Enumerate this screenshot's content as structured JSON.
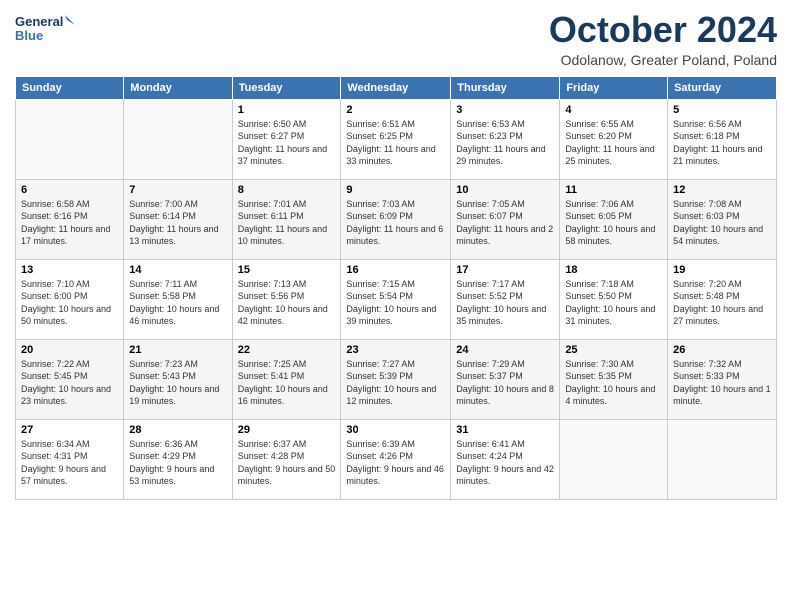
{
  "header": {
    "logo_line1": "General",
    "logo_line2": "Blue",
    "month": "October 2024",
    "location": "Odolanow, Greater Poland, Poland"
  },
  "weekdays": [
    "Sunday",
    "Monday",
    "Tuesday",
    "Wednesday",
    "Thursday",
    "Friday",
    "Saturday"
  ],
  "weeks": [
    [
      {
        "day": "",
        "sunrise": "",
        "sunset": "",
        "daylight": ""
      },
      {
        "day": "",
        "sunrise": "",
        "sunset": "",
        "daylight": ""
      },
      {
        "day": "1",
        "sunrise": "Sunrise: 6:50 AM",
        "sunset": "Sunset: 6:27 PM",
        "daylight": "Daylight: 11 hours and 37 minutes."
      },
      {
        "day": "2",
        "sunrise": "Sunrise: 6:51 AM",
        "sunset": "Sunset: 6:25 PM",
        "daylight": "Daylight: 11 hours and 33 minutes."
      },
      {
        "day": "3",
        "sunrise": "Sunrise: 6:53 AM",
        "sunset": "Sunset: 6:23 PM",
        "daylight": "Daylight: 11 hours and 29 minutes."
      },
      {
        "day": "4",
        "sunrise": "Sunrise: 6:55 AM",
        "sunset": "Sunset: 6:20 PM",
        "daylight": "Daylight: 11 hours and 25 minutes."
      },
      {
        "day": "5",
        "sunrise": "Sunrise: 6:56 AM",
        "sunset": "Sunset: 6:18 PM",
        "daylight": "Daylight: 11 hours and 21 minutes."
      }
    ],
    [
      {
        "day": "6",
        "sunrise": "Sunrise: 6:58 AM",
        "sunset": "Sunset: 6:16 PM",
        "daylight": "Daylight: 11 hours and 17 minutes."
      },
      {
        "day": "7",
        "sunrise": "Sunrise: 7:00 AM",
        "sunset": "Sunset: 6:14 PM",
        "daylight": "Daylight: 11 hours and 13 minutes."
      },
      {
        "day": "8",
        "sunrise": "Sunrise: 7:01 AM",
        "sunset": "Sunset: 6:11 PM",
        "daylight": "Daylight: 11 hours and 10 minutes."
      },
      {
        "day": "9",
        "sunrise": "Sunrise: 7:03 AM",
        "sunset": "Sunset: 6:09 PM",
        "daylight": "Daylight: 11 hours and 6 minutes."
      },
      {
        "day": "10",
        "sunrise": "Sunrise: 7:05 AM",
        "sunset": "Sunset: 6:07 PM",
        "daylight": "Daylight: 11 hours and 2 minutes."
      },
      {
        "day": "11",
        "sunrise": "Sunrise: 7:06 AM",
        "sunset": "Sunset: 6:05 PM",
        "daylight": "Daylight: 10 hours and 58 minutes."
      },
      {
        "day": "12",
        "sunrise": "Sunrise: 7:08 AM",
        "sunset": "Sunset: 6:03 PM",
        "daylight": "Daylight: 10 hours and 54 minutes."
      }
    ],
    [
      {
        "day": "13",
        "sunrise": "Sunrise: 7:10 AM",
        "sunset": "Sunset: 6:00 PM",
        "daylight": "Daylight: 10 hours and 50 minutes."
      },
      {
        "day": "14",
        "sunrise": "Sunrise: 7:11 AM",
        "sunset": "Sunset: 5:58 PM",
        "daylight": "Daylight: 10 hours and 46 minutes."
      },
      {
        "day": "15",
        "sunrise": "Sunrise: 7:13 AM",
        "sunset": "Sunset: 5:56 PM",
        "daylight": "Daylight: 10 hours and 42 minutes."
      },
      {
        "day": "16",
        "sunrise": "Sunrise: 7:15 AM",
        "sunset": "Sunset: 5:54 PM",
        "daylight": "Daylight: 10 hours and 39 minutes."
      },
      {
        "day": "17",
        "sunrise": "Sunrise: 7:17 AM",
        "sunset": "Sunset: 5:52 PM",
        "daylight": "Daylight: 10 hours and 35 minutes."
      },
      {
        "day": "18",
        "sunrise": "Sunrise: 7:18 AM",
        "sunset": "Sunset: 5:50 PM",
        "daylight": "Daylight: 10 hours and 31 minutes."
      },
      {
        "day": "19",
        "sunrise": "Sunrise: 7:20 AM",
        "sunset": "Sunset: 5:48 PM",
        "daylight": "Daylight: 10 hours and 27 minutes."
      }
    ],
    [
      {
        "day": "20",
        "sunrise": "Sunrise: 7:22 AM",
        "sunset": "Sunset: 5:45 PM",
        "daylight": "Daylight: 10 hours and 23 minutes."
      },
      {
        "day": "21",
        "sunrise": "Sunrise: 7:23 AM",
        "sunset": "Sunset: 5:43 PM",
        "daylight": "Daylight: 10 hours and 19 minutes."
      },
      {
        "day": "22",
        "sunrise": "Sunrise: 7:25 AM",
        "sunset": "Sunset: 5:41 PM",
        "daylight": "Daylight: 10 hours and 16 minutes."
      },
      {
        "day": "23",
        "sunrise": "Sunrise: 7:27 AM",
        "sunset": "Sunset: 5:39 PM",
        "daylight": "Daylight: 10 hours and 12 minutes."
      },
      {
        "day": "24",
        "sunrise": "Sunrise: 7:29 AM",
        "sunset": "Sunset: 5:37 PM",
        "daylight": "Daylight: 10 hours and 8 minutes."
      },
      {
        "day": "25",
        "sunrise": "Sunrise: 7:30 AM",
        "sunset": "Sunset: 5:35 PM",
        "daylight": "Daylight: 10 hours and 4 minutes."
      },
      {
        "day": "26",
        "sunrise": "Sunrise: 7:32 AM",
        "sunset": "Sunset: 5:33 PM",
        "daylight": "Daylight: 10 hours and 1 minute."
      }
    ],
    [
      {
        "day": "27",
        "sunrise": "Sunrise: 6:34 AM",
        "sunset": "Sunset: 4:31 PM",
        "daylight": "Daylight: 9 hours and 57 minutes."
      },
      {
        "day": "28",
        "sunrise": "Sunrise: 6:36 AM",
        "sunset": "Sunset: 4:29 PM",
        "daylight": "Daylight: 9 hours and 53 minutes."
      },
      {
        "day": "29",
        "sunrise": "Sunrise: 6:37 AM",
        "sunset": "Sunset: 4:28 PM",
        "daylight": "Daylight: 9 hours and 50 minutes."
      },
      {
        "day": "30",
        "sunrise": "Sunrise: 6:39 AM",
        "sunset": "Sunset: 4:26 PM",
        "daylight": "Daylight: 9 hours and 46 minutes."
      },
      {
        "day": "31",
        "sunrise": "Sunrise: 6:41 AM",
        "sunset": "Sunset: 4:24 PM",
        "daylight": "Daylight: 9 hours and 42 minutes."
      },
      {
        "day": "",
        "sunrise": "",
        "sunset": "",
        "daylight": ""
      },
      {
        "day": "",
        "sunrise": "",
        "sunset": "",
        "daylight": ""
      }
    ]
  ]
}
